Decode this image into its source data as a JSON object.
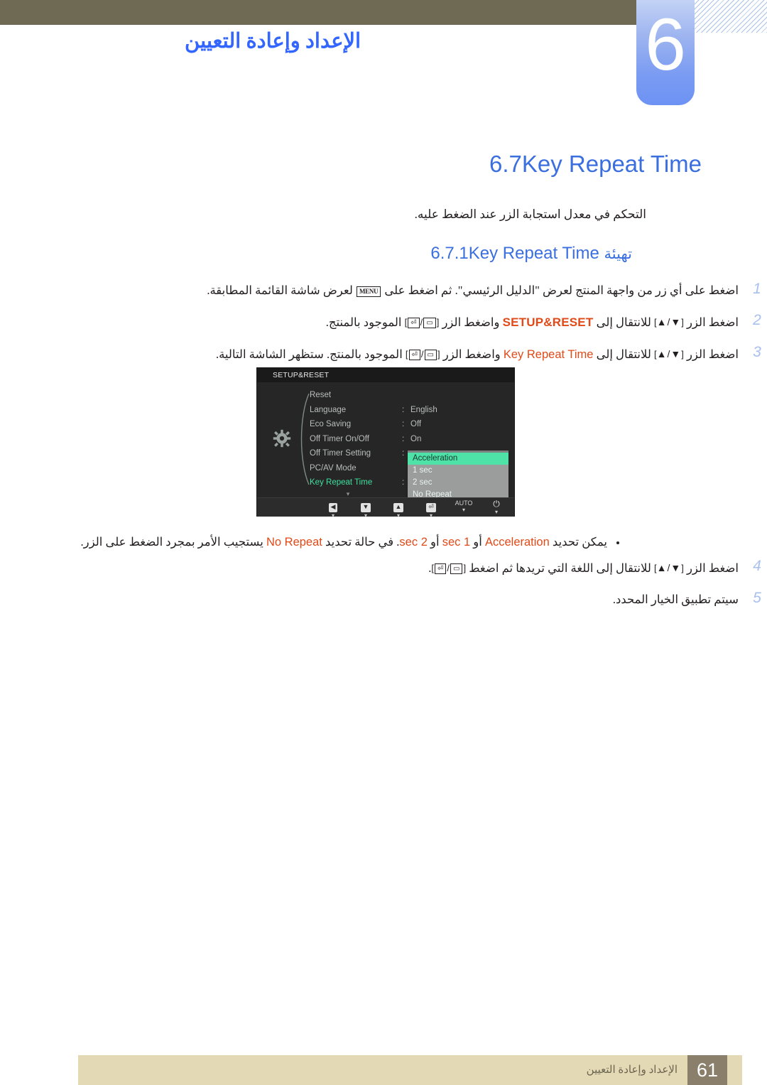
{
  "document": {
    "language": "ar",
    "colors": {
      "header_bar": "#6f6a54",
      "chapter_blue": "#6d92f4",
      "heading_blue": "#3b6fe0",
      "step_number_blue": "#a8c0ef",
      "highlight_orange": "#e04a18",
      "footer_band": "#e3d9b4",
      "footer_page_box": "#8a7f6b",
      "osd_accent_green": "#4fe2a8"
    }
  },
  "header": {
    "chapter_number": "6",
    "chapter_title": "الإعداد وإعادة التعيين",
    "hatch_icon": "diagonal-hatch-decoration"
  },
  "section": {
    "number": "6.7",
    "title": "Key Repeat Time",
    "intro": "التحكم في معدل استجابة الزر عند الضغط عليه.",
    "subsection": {
      "number": "6.7.1",
      "title_latin": "Key Repeat Time",
      "title_arabic": "تهيئة"
    }
  },
  "steps": [
    {
      "number": "1",
      "segments": [
        {
          "type": "text",
          "value": "اضغط على أي زر من واجهة المنتج لعرض \"الدليل الرئيسي\". ثم اضغط على "
        },
        {
          "type": "key",
          "value": "MENU"
        },
        {
          "type": "text",
          "value": " لعرض شاشة القائمة المطابقة."
        }
      ]
    },
    {
      "number": "2",
      "segments": [
        {
          "type": "text",
          "value": "اضغط الزر "
        },
        {
          "type": "keys_arrows",
          "value": "▲/▼"
        },
        {
          "type": "text",
          "value": " للانتقال إلى "
        },
        {
          "type": "highlight",
          "value": "SETUP&RESET"
        },
        {
          "type": "text",
          "value": " واضغط الزر "
        },
        {
          "type": "keys_enter",
          "value": "⏎/▭"
        },
        {
          "type": "text",
          "value": " الموجود بالمنتج."
        }
      ]
    },
    {
      "number": "3",
      "segments": [
        {
          "type": "text",
          "value": "اضغط الزر "
        },
        {
          "type": "keys_arrows",
          "value": "▲/▼"
        },
        {
          "type": "text",
          "value": " للانتقال إلى "
        },
        {
          "type": "highlight",
          "value": "Key Repeat Time"
        },
        {
          "type": "text",
          "value": " واضغط الزر "
        },
        {
          "type": "keys_enter",
          "value": "⏎/▭"
        },
        {
          "type": "text",
          "value": " الموجود بالمنتج. ستظهر الشاشة التالية."
        }
      ]
    }
  ],
  "note": {
    "bullet": "•",
    "segments": [
      {
        "type": "text",
        "value": "يمكن تحديد "
      },
      {
        "type": "highlight",
        "value": "Acceleration"
      },
      {
        "type": "text",
        "value": " أو "
      },
      {
        "type": "highlight",
        "value": "1 sec"
      },
      {
        "type": "text",
        "value": " أو "
      },
      {
        "type": "highlight",
        "value": "2 sec"
      },
      {
        "type": "text",
        "value": ". في حالة تحديد "
      },
      {
        "type": "highlight",
        "value": "No Repeat"
      },
      {
        "type": "text",
        "value": " يستجيب الأمر بمجرد الضغط على الزر."
      }
    ]
  },
  "steps2": [
    {
      "number": "4",
      "segments": [
        {
          "type": "text",
          "value": "اضغط الزر "
        },
        {
          "type": "keys_arrows",
          "value": "▲/▼"
        },
        {
          "type": "text",
          "value": " للانتقال إلى اللغة التي تريدها ثم اضغط "
        },
        {
          "type": "keys_enter",
          "value": "⏎/▭"
        },
        {
          "type": "text",
          "value": "."
        }
      ]
    },
    {
      "number": "5",
      "segments": [
        {
          "type": "text",
          "value": "سيتم تطبيق الخيار المحدد."
        }
      ]
    }
  ],
  "osd": {
    "title": "SETUP&RESET",
    "gear_icon": "gear-icon",
    "rows": [
      {
        "label": "Reset",
        "colon": "",
        "value": "",
        "active": false
      },
      {
        "label": "Language",
        "colon": ":",
        "value": "English",
        "active": false
      },
      {
        "label": "Eco Saving",
        "colon": ":",
        "value": "Off",
        "active": false
      },
      {
        "label": "Off Timer On/Off",
        "colon": ":",
        "value": "On",
        "active": false
      },
      {
        "label": "Off Timer Setting",
        "colon": ":",
        "value": "",
        "active": false
      },
      {
        "label": "PC/AV Mode",
        "colon": "",
        "value": "",
        "active": false
      },
      {
        "label": "Key Repeat Time",
        "colon": ":",
        "value": "",
        "active": true
      }
    ],
    "scroll_down_indicator": "▾",
    "popup": {
      "selected": "Acceleration",
      "options": [
        "Acceleration",
        "1 sec",
        "2 sec",
        "No Repeat"
      ]
    },
    "buttons": [
      {
        "name": "left-arrow-button",
        "glyph": "◀",
        "caption": "",
        "tick": "▾"
      },
      {
        "name": "down-arrow-button",
        "glyph": "▼",
        "caption": "",
        "tick": "▾"
      },
      {
        "name": "up-arrow-button",
        "glyph": "▲",
        "caption": "",
        "tick": "▾"
      },
      {
        "name": "enter-button",
        "glyph": "⏎",
        "caption": "",
        "tick": "▾"
      },
      {
        "name": "auto-button",
        "glyph": "",
        "caption": "AUTO",
        "tick": "▾"
      },
      {
        "name": "power-button",
        "glyph": "⏻",
        "caption": "",
        "tick": "▾"
      }
    ]
  },
  "footer": {
    "page_number": "61",
    "chapter_label": "الإعداد وإعادة التعيين"
  }
}
